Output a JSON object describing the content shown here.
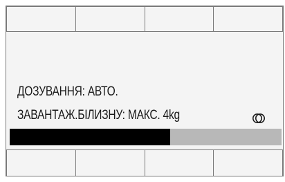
{
  "display": {
    "dosing_text": "ДОЗУВАННЯ: АВТО.",
    "load_text": "ЗАВАНТАЖ.БІЛИЗНУ: МАКС. 4kg",
    "progress_fraction": 0.59,
    "icon": "double-circle-icon"
  },
  "softkeys_top": [
    "",
    "",
    "",
    ""
  ],
  "softkeys_bottom": [
    "",
    "",
    "",
    ""
  ],
  "colors": {
    "background": "#f4f4f4",
    "border": "#7a7a7a",
    "text": "#1a1a1a",
    "progress_fill": "#000000",
    "progress_track": "#b8b8b8"
  }
}
